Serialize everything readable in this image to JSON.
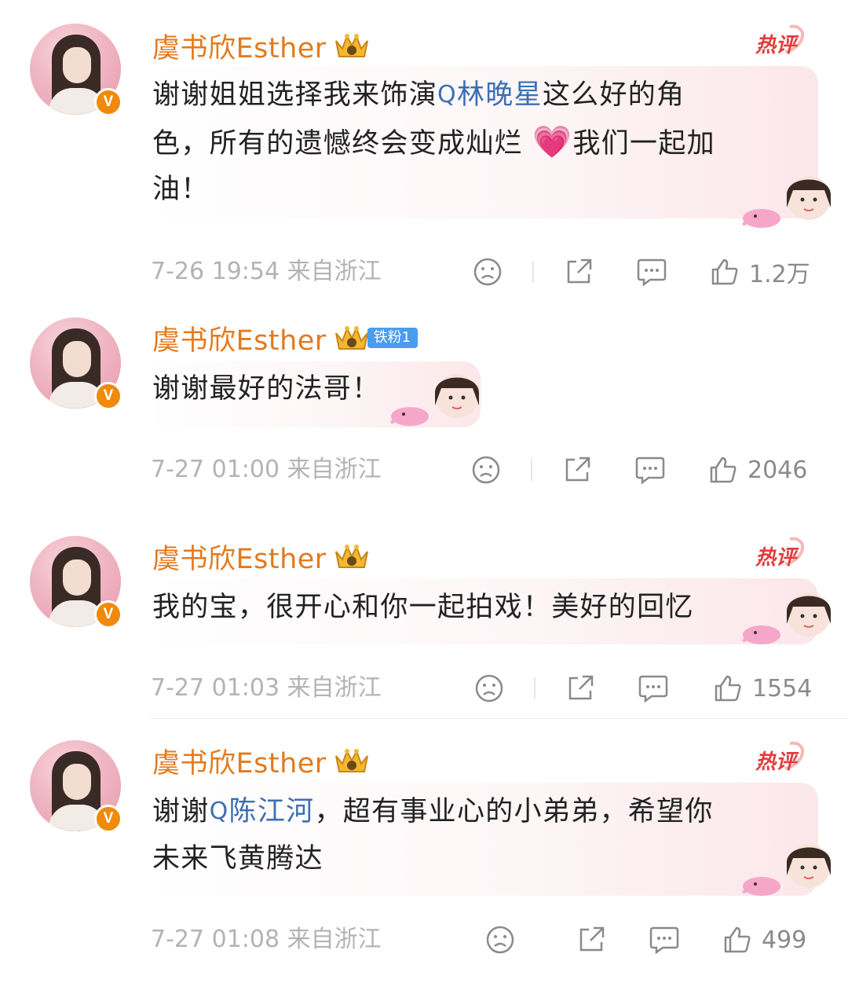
{
  "comments": [
    {
      "username": "虞书欣Esther",
      "verified_badge": "V",
      "hot_label": "热评",
      "text_lines": [
        "谢谢姐姐选择我来饰演",
        "色，所有的遗憾终会变成灿烂",
        "油！"
      ],
      "topic_after_line1": "林晚星",
      "line1_tail": "这么好的角",
      "line2_tail": "我们一起加",
      "emoji": "heart-emoji",
      "time": "7-26 19:54",
      "location": "来自浙江",
      "likes": "1.2万"
    },
    {
      "username": "虞书欣Esther",
      "verified_badge": "V",
      "fan_badge": "铁粉1",
      "text": "谢谢最好的法哥！",
      "time": "7-27 01:00",
      "location": "来自浙江",
      "likes": "2046"
    },
    {
      "username": "虞书欣Esther",
      "verified_badge": "V",
      "hot_label": "热评",
      "text": "我的宝，很开心和你一起拍戏！美好的回忆",
      "time": "7-27 01:03",
      "location": "来自浙江",
      "likes": "1554"
    },
    {
      "username": "虞书欣Esther",
      "verified_badge": "V",
      "hot_label": "热评",
      "line1_head": "谢谢",
      "topic": "陈江河",
      "line1_tail": "，超有事业心的小弟弟，希望你",
      "line2": "未来飞黄腾达",
      "time": "7-27 01:08",
      "location": "来自浙江",
      "likes": "499"
    }
  ],
  "topic_search_glyph": "Q",
  "colors": {
    "username": "#e27a1e",
    "topic": "#3c6fb3",
    "hot": "#e23c3c",
    "meta": "#b3b3b3",
    "fan_badge": "#4a9cf0"
  },
  "icons": [
    "sad-face-icon",
    "share-icon",
    "comment-icon",
    "thumbs-up-icon",
    "crown-icon",
    "search-icon"
  ]
}
